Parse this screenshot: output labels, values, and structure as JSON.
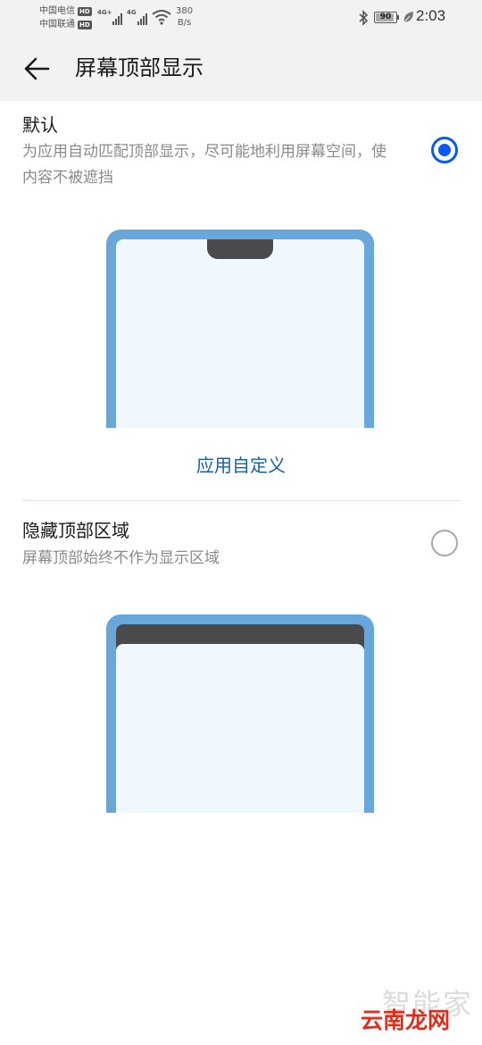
{
  "status_bar": {
    "carrier_1": "中国电信",
    "carrier_2": "中国联通",
    "hd_badge": "HD",
    "signal_1_tag": "4G+",
    "signal_2_tag": "4G",
    "net_speed_value": "380",
    "net_speed_unit": "B/s",
    "battery": "90",
    "battery_level": 0.9,
    "time": "2:03"
  },
  "header": {
    "title": "屏幕顶部显示"
  },
  "options": [
    {
      "title": "默认",
      "description": "为应用自动匹配顶部显示，尽可能地利用屏幕空间，使内容不被遮挡",
      "selected": true
    },
    {
      "title": "隐藏顶部区域",
      "description": "屏幕顶部始终不作为显示区域",
      "selected": false
    }
  ],
  "customize_link": "应用自定义",
  "watermark": {
    "top": "智能家",
    "bottom": "云南龙网"
  },
  "colors": {
    "accent": "#0a59f7",
    "link": "#1560a8",
    "phone_frame": "#67a7d9",
    "phone_screen": "#f1f8fd",
    "notch": "#4a4a4a"
  }
}
